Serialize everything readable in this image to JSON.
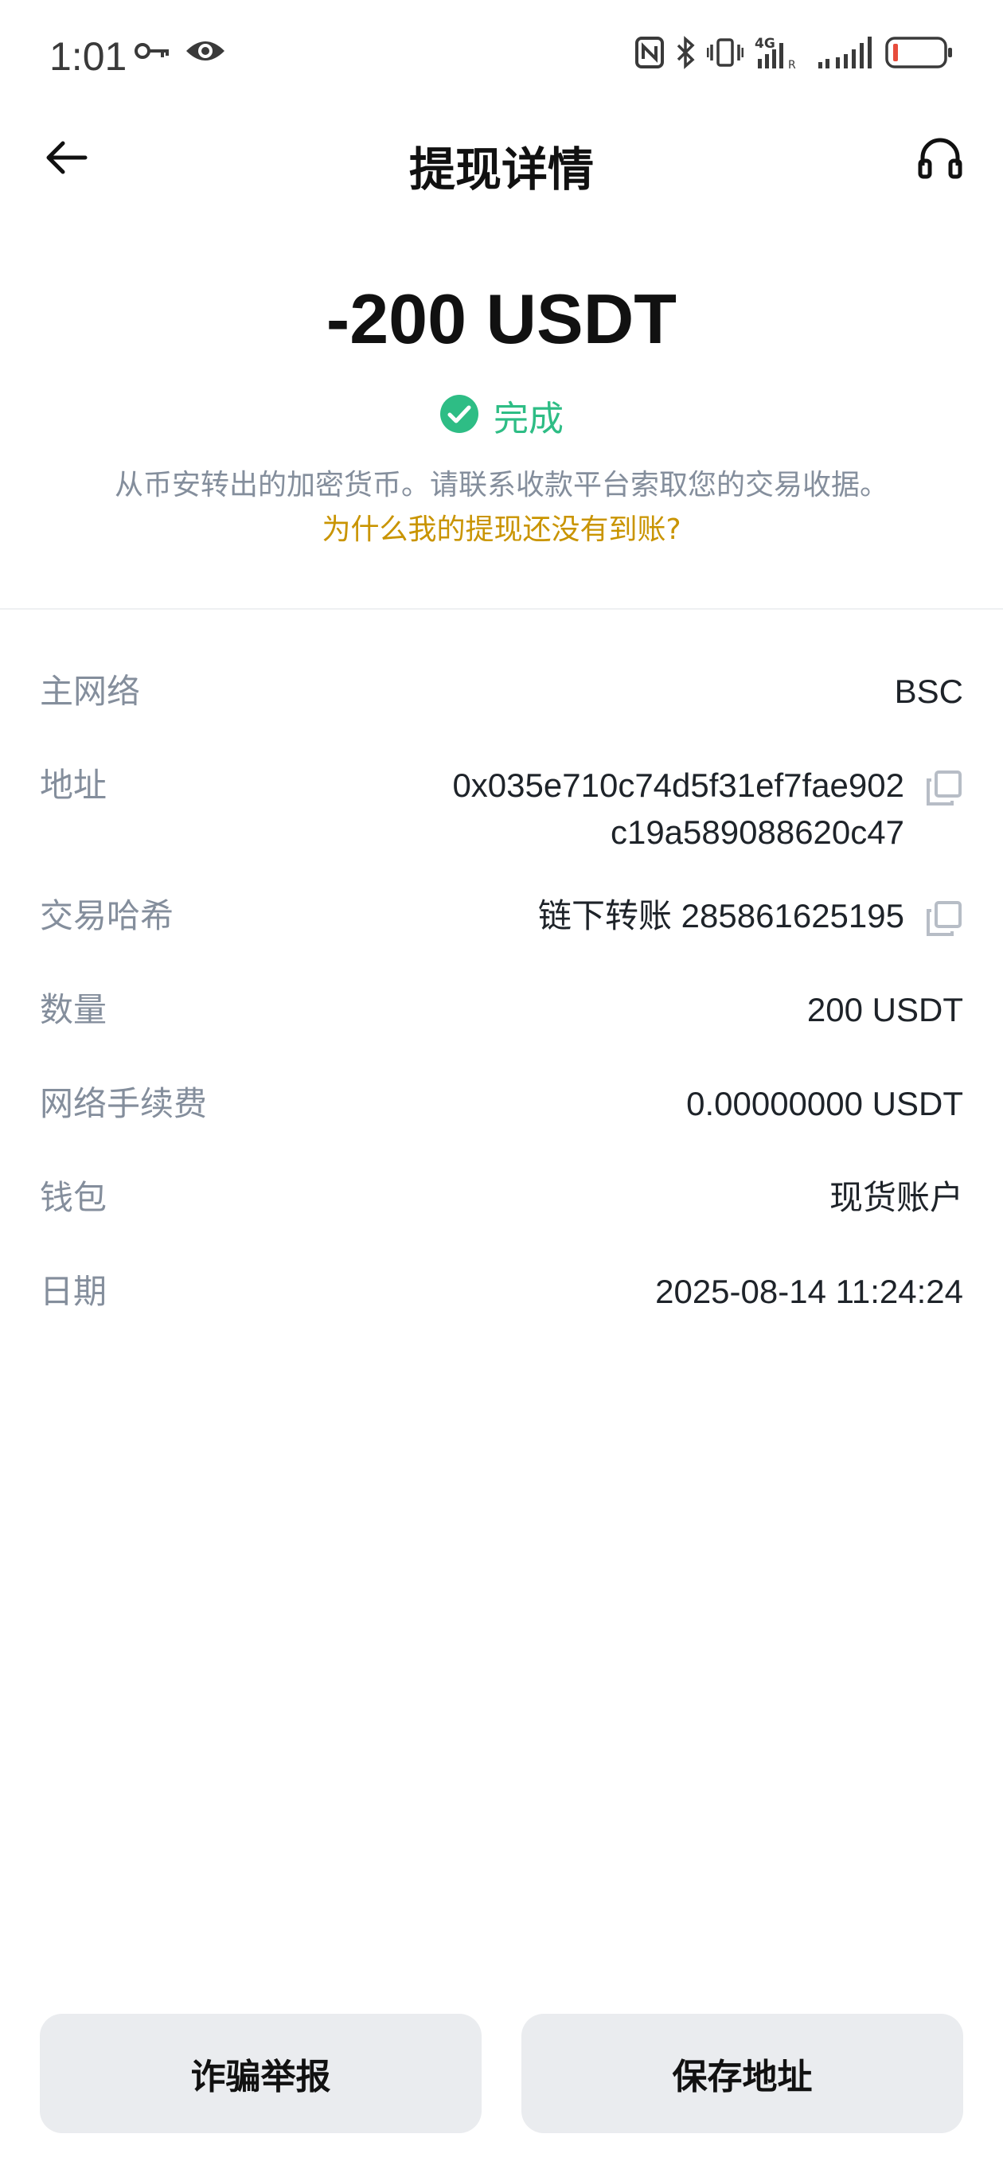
{
  "status_bar": {
    "time": "1:01",
    "network_label": "4G",
    "colors": {
      "battery_low": "#e74c3c"
    }
  },
  "header": {
    "title": "提现详情",
    "back_icon": "arrow-left-icon",
    "support_icon": "headset-icon"
  },
  "summary": {
    "amount": "-200 USDT",
    "status": "完成",
    "status_color": "#2ebd85",
    "notice": "从币安转出的加密货币。请联系收款平台索取您的交易收据。",
    "help_link": "为什么我的提现还没有到账?",
    "help_link_color": "#c99400"
  },
  "details": {
    "network": {
      "label": "主网络",
      "value": "BSC"
    },
    "address": {
      "label": "地址",
      "line1": "0x035e710c74d5f31ef7fae902",
      "line2": "c19a589088620c47"
    },
    "tx_hash": {
      "label": "交易哈希",
      "value": "链下转账 285861625195"
    },
    "amount": {
      "label": "数量",
      "value": "200 USDT"
    },
    "fee": {
      "label": "网络手续费",
      "value": "0.00000000 USDT"
    },
    "wallet": {
      "label": "钱包",
      "value": "现货账户"
    },
    "date": {
      "label": "日期",
      "value": "2025-08-14 11:24:24"
    }
  },
  "buttons": {
    "report": "诈骗举报",
    "save_address": "保存地址"
  }
}
